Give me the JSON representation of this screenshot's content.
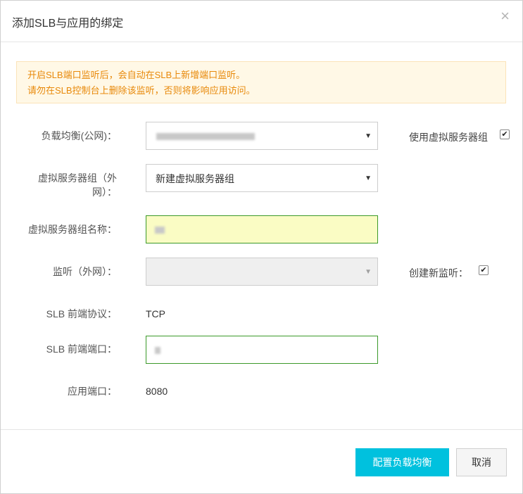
{
  "dialog": {
    "title": "添加SLB与应用的绑定",
    "close_glyph": "×"
  },
  "notice": {
    "line1": "开启SLB端口监听后，会自动在SLB上新增端口监听。",
    "line2": "请勿在SLB控制台上删除该监听，否则将影响应用访问。"
  },
  "form": {
    "slb_label": "负载均衡(公网)：",
    "slb_value_obscured": true,
    "use_vsg_label": "使用虚拟服务器组",
    "use_vsg_checked": true,
    "vsg_label_line1": "虚拟服务器组（外",
    "vsg_label_line2": "网）：",
    "vsg_value": "新建虚拟服务器组",
    "vsg_name_label": "虚拟服务器组名称：",
    "vsg_name_value_obscured": true,
    "listener_label": "监听（外网）：",
    "listener_value": "",
    "create_listener_label": "创建新监听：",
    "create_listener_checked": true,
    "protocol_label": "SLB 前端协议：",
    "protocol_value": "TCP",
    "front_port_label": "SLB 前端端口：",
    "front_port_value_obscured": true,
    "app_port_label": "应用端口：",
    "app_port_value": "8080"
  },
  "footer": {
    "confirm_label": "配置负载均衡",
    "cancel_label": "取消"
  },
  "colors": {
    "primary": "#00c1de",
    "notice_text": "#e8890a",
    "notice_bg": "#fff8e6",
    "focus_border": "#3c9a2a",
    "autofill_bg": "#fafcc4"
  },
  "icons": {
    "close": "close-icon",
    "caret": "caret-down-icon",
    "check": "checkmark-icon"
  }
}
